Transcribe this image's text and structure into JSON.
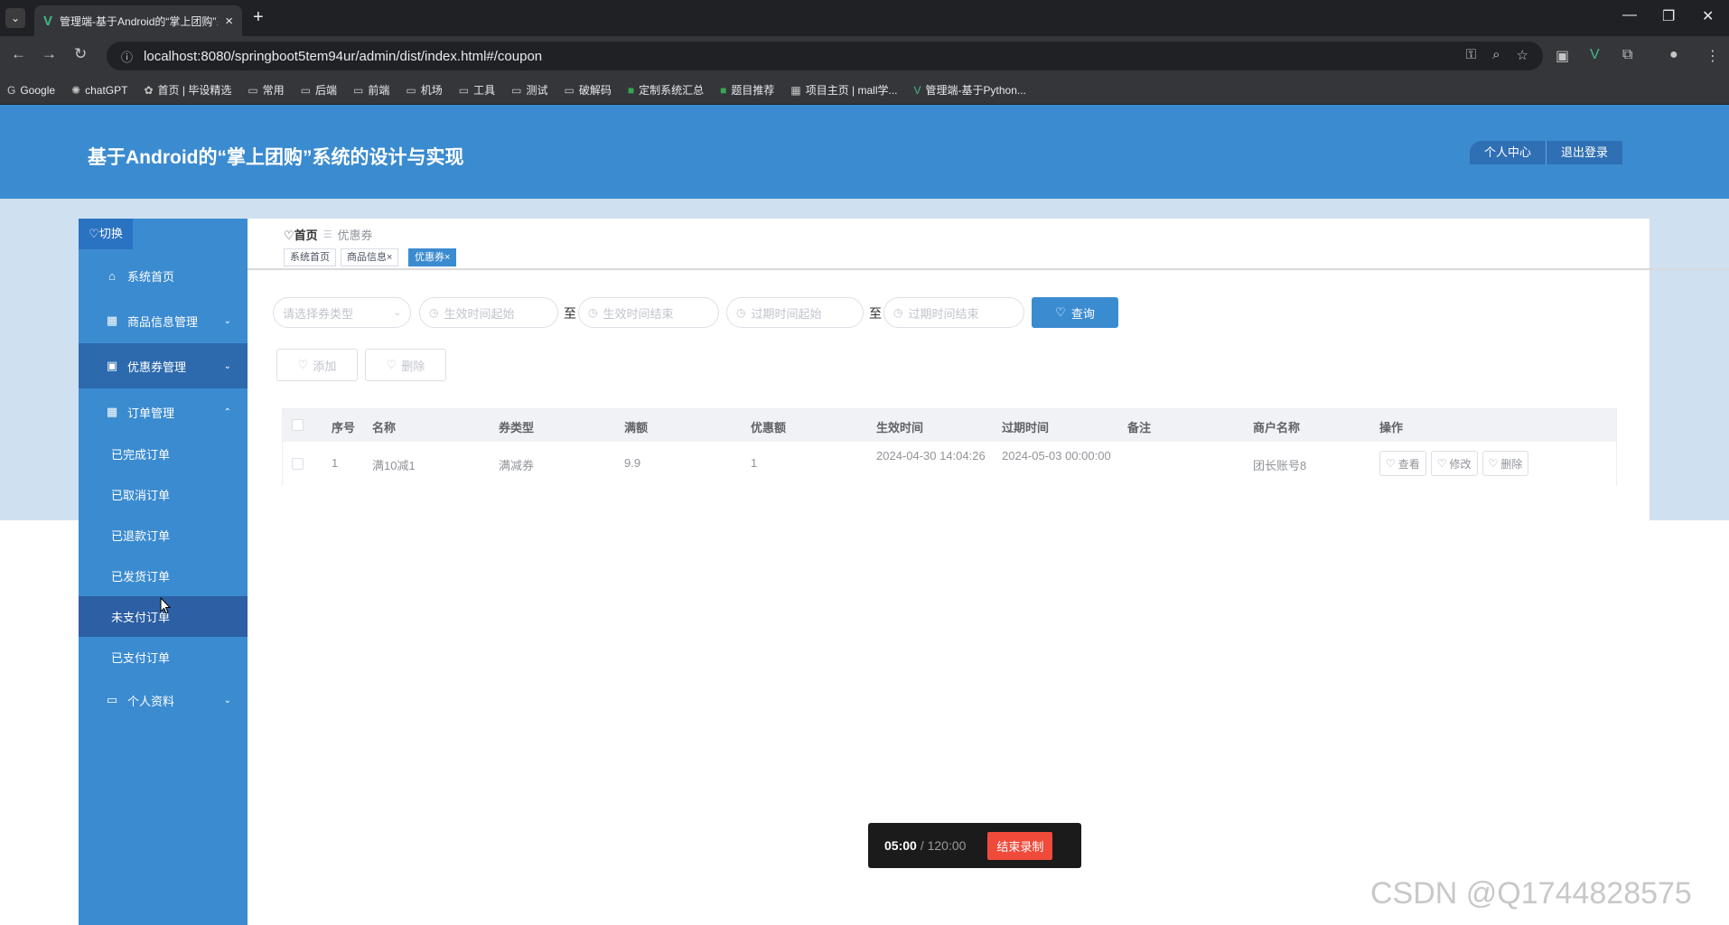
{
  "browser": {
    "tab_title": "管理端-基于Android的“掌上团购”系统的设计与实现",
    "url": "localhost:8080/springboot5tem94ur/admin/dist/index.html#/coupon",
    "bookmarks": [
      "Google",
      "chatGPT",
      "首页 | 毕设精选",
      "常用",
      "后端",
      "前端",
      "机场",
      "工具",
      "测试",
      "破解码",
      "定制系统汇总",
      "题目推荐",
      "项目主页 | mall学...",
      "管理端-基于Python..."
    ]
  },
  "header": {
    "title": "基于Android的“掌上团购”系统的设计与实现",
    "personal_center": "个人中心",
    "logout": "退出登录"
  },
  "sidebar": {
    "toggle": "切换",
    "items": [
      {
        "label": "系统首页",
        "icon": "home-icon"
      },
      {
        "label": "商品信息管理",
        "icon": "grid-icon"
      },
      {
        "label": "优惠券管理",
        "icon": "clipboard-icon"
      },
      {
        "label": "订单管理",
        "icon": "grid-icon"
      },
      {
        "label": "个人资料",
        "icon": "card-icon"
      }
    ],
    "order_subitems": [
      "已完成订单",
      "已取消订单",
      "已退款订单",
      "已发货订单",
      "未支付订单",
      "已支付订单"
    ]
  },
  "breadcrumb": {
    "home": "首页",
    "current": "优惠券"
  },
  "tags": [
    {
      "label": "系统首页"
    },
    {
      "label": "商品信息×"
    },
    {
      "label": "优惠券×"
    }
  ],
  "filters": {
    "type_placeholder": "请选择券类型",
    "effective_start": "生效时间起始",
    "effective_end": "生效时间结束",
    "expire_start": "过期时间起始",
    "expire_end": "过期时间结束",
    "to": "至",
    "search": "查询"
  },
  "actions": {
    "add": "添加",
    "delete": "删除"
  },
  "table": {
    "headers": [
      "序号",
      "名称",
      "券类型",
      "满额",
      "优惠额",
      "生效时间",
      "过期时间",
      "备注",
      "商户名称",
      "操作"
    ],
    "rows": [
      {
        "index": "1",
        "name": "满10减1",
        "type": "满减券",
        "threshold": "9.9",
        "discount": "1",
        "effective": "2024-04-30 14:04:26",
        "expire": "2024-05-03 00:00:00",
        "remark": "",
        "merchant": "团长账号8"
      }
    ],
    "ops": {
      "view": "查看",
      "edit": "修改",
      "delete": "删除"
    }
  },
  "recorder": {
    "elapsed": "05:00",
    "total": "/ 120:00",
    "stop": "结束录制"
  },
  "watermark": "CSDN @Q1744828575"
}
